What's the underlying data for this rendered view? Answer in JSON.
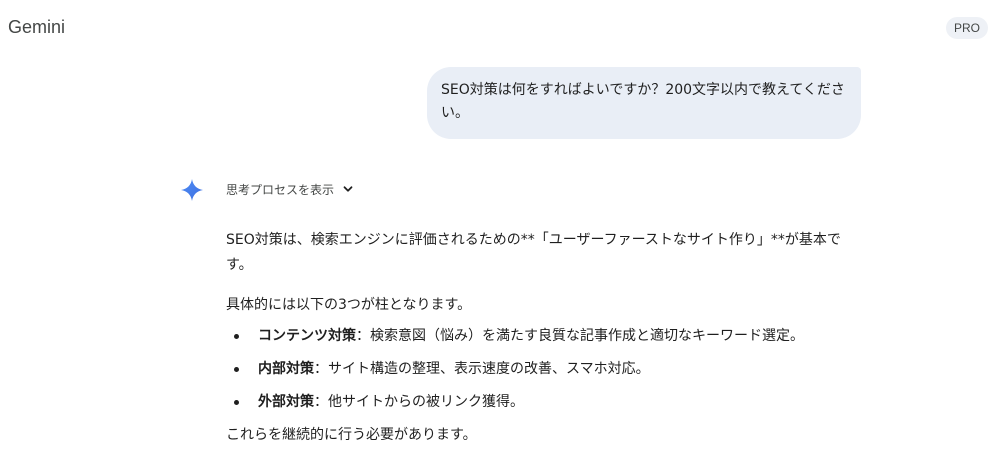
{
  "header": {
    "app_title": "Gemini",
    "badge": "PRO"
  },
  "user_message": {
    "text": "SEO対策は何をすればよいですか？200文字以内で教えてください。"
  },
  "assistant": {
    "icon": "gemini-sparkle-icon",
    "thinking_label": "思考プロセスを表示",
    "paragraph1": "SEO対策は、検索エンジンに評価されるための**「ユーザーファーストなサイト作り」**が基本です。",
    "paragraph2": "具体的には以下の3つが柱となります。",
    "bullets": [
      {
        "title": "コンテンツ対策",
        "body": "：検索意図（悩み）を満たす良質な記事作成と適切なキーワード選定。"
      },
      {
        "title": "内部対策",
        "body": "：サイト構造の整理、表示速度の改善、スマホ対応。"
      },
      {
        "title": "外部対策",
        "body": "：他サイトからの被リンク獲得。"
      }
    ],
    "paragraph3": "これらを継続的に行う必要があります。"
  },
  "colors": {
    "user_bubble": "#e9eef6",
    "sparkle_blue": "#4285f4",
    "text": "#1f1f1f",
    "muted": "#444746"
  }
}
